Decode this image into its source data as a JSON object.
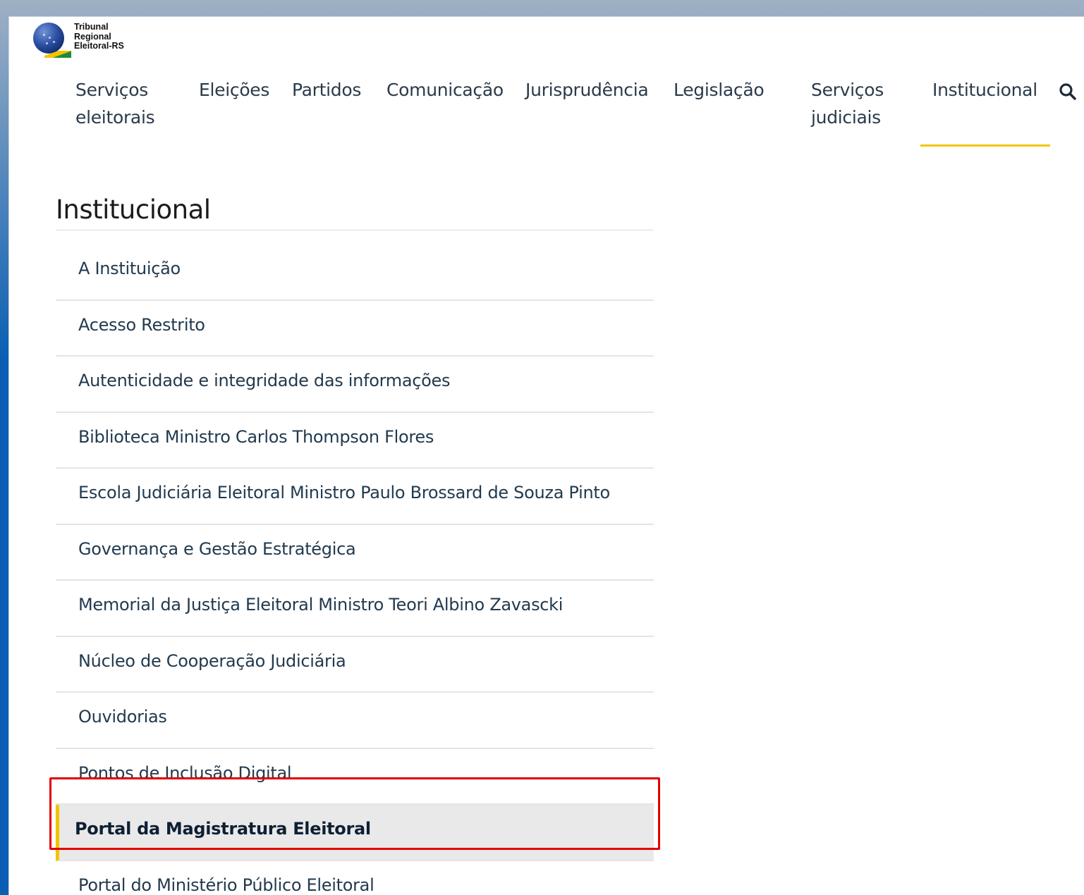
{
  "logo": {
    "lines": [
      "Tribunal",
      "Regional",
      "Eleitoral-RS"
    ]
  },
  "nav": {
    "items": [
      {
        "label": "Serviços eleitorais",
        "active": false
      },
      {
        "label": "Eleições",
        "active": false
      },
      {
        "label": "Partidos",
        "active": false
      },
      {
        "label": "Comunicação",
        "active": false
      },
      {
        "label": "Jurisprudência",
        "active": false
      },
      {
        "label": "Legislação",
        "active": false
      },
      {
        "label": "Serviços judiciais",
        "active": false
      },
      {
        "label": "Institucional",
        "active": true
      }
    ],
    "search_icon": "search-icon"
  },
  "section": {
    "title": "Institucional",
    "items": [
      {
        "label": "A Instituição"
      },
      {
        "label": "Acesso Restrito"
      },
      {
        "label": "Autenticidade e integridade das informações"
      },
      {
        "label": "Biblioteca Ministro Carlos Thompson Flores"
      },
      {
        "label": "Escola Judiciária Eleitoral Ministro Paulo Brossard de Souza Pinto"
      },
      {
        "label": "Governança e Gestão Estratégica"
      },
      {
        "label": "Memorial da Justiça Eleitoral Ministro Teori Albino Zavascki"
      },
      {
        "label": "Núcleo de Cooperação Judiciária"
      },
      {
        "label": "Ouvidorias"
      },
      {
        "label": "Pontos de Inclusão Digital"
      },
      {
        "label": "Portal da Magistratura Eleitoral",
        "active": true
      },
      {
        "label": "Portal do Ministério Público Eleitoral"
      }
    ]
  },
  "colors": {
    "accent_yellow": "#f2c400",
    "highlight_red": "#e10000",
    "background_blue": "#0a5fb4"
  }
}
